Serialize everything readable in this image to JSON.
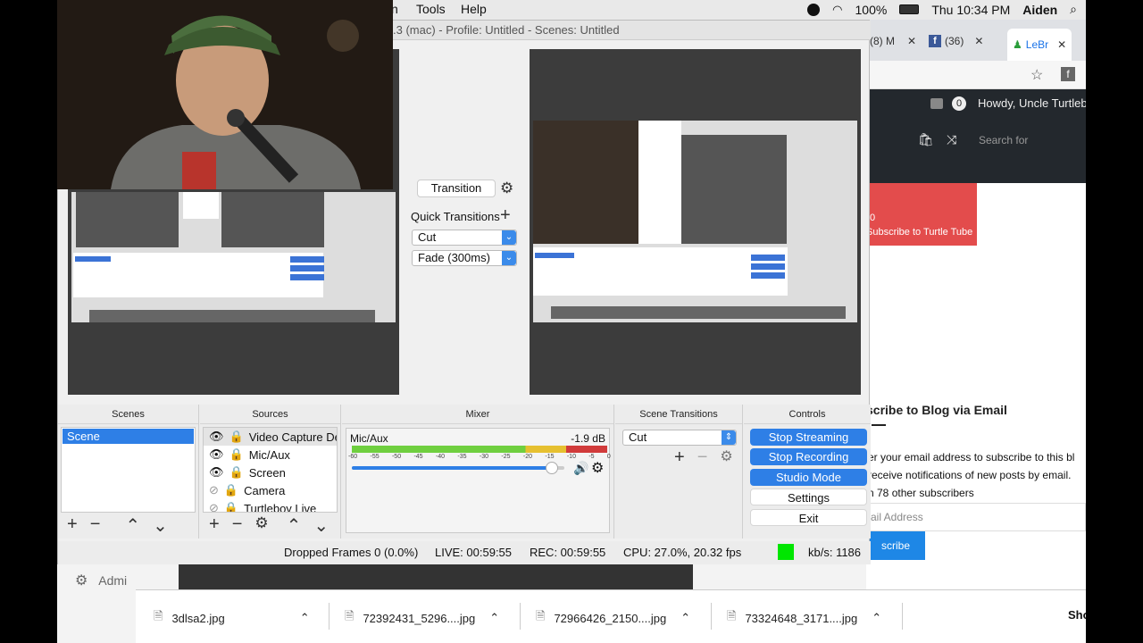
{
  "menubar": {
    "items": [
      "n",
      "Tools",
      "Help"
    ],
    "battery": "100%",
    "datetime": "Thu 10:34 PM",
    "user": "Aiden"
  },
  "browser": {
    "tabs": [
      "(8) M",
      "(36)",
      "LeBr"
    ],
    "wp_greeting": "Howdy, Uncle Turtleb",
    "search_placeholder": "Search for",
    "red_button": "Subscribe to Turtle Tube",
    "red_button_prefix": "0",
    "blog_heading": "scribe to Blog via Email",
    "blog_line1": "er your email address to subscribe to this bl",
    "blog_line2": "receive notifications of new posts by email.",
    "blog_line3": "n 78 other subscribers",
    "email_placeholder": "ail Address",
    "subscribe_btn": "scribe"
  },
  "obs": {
    "title": ".3 (mac) - Profile: Untitled - Scenes: Untitled",
    "transition_btn": "Transition",
    "quick_transitions": "Quick Transitions",
    "quick_cut": "Cut",
    "quick_fade": "Fade (300ms)",
    "panels": {
      "scenes": "Scenes",
      "sources": "Sources",
      "mixer": "Mixer",
      "scene_transitions": "Scene Transitions",
      "controls": "Controls"
    },
    "scenes": [
      "Scene"
    ],
    "sources": [
      "Video Capture Dev",
      "Mic/Aux",
      "Screen",
      "Camera",
      "Turtleboy Live"
    ],
    "mixer": {
      "name": "Mic/Aux",
      "db": "-1.9 dB",
      "ticks": [
        "-60",
        "-55",
        "-50",
        "-45",
        "-40",
        "-35",
        "-30",
        "-25",
        "-20",
        "-15",
        "-10",
        "-5",
        "0"
      ],
      "volume_level": 0.94
    },
    "scene_transition_value": "Cut",
    "controls": {
      "stop_streaming": "Stop Streaming",
      "stop_recording": "Stop Recording",
      "studio_mode": "Studio Mode",
      "settings": "Settings",
      "exit": "Exit"
    },
    "status": {
      "dropped": "Dropped Frames 0 (0.0%)",
      "live": "LIVE: 00:59:55",
      "rec": "REC: 00:59:55",
      "cpu": "CPU: 27.0%, 20.32 fps",
      "kbs": "kb/s: 1186"
    }
  },
  "admin_label": "Admi",
  "downloads": [
    "3dlsa2.jpg",
    "72392431_5296....jpg",
    "72966426_2150....jpg",
    "73324648_3171....jpg"
  ],
  "downloads_show": "Sho",
  "colors": {
    "accent": "#2e7fe6",
    "live_indicator": "#00e600",
    "wp_bar": "#23282d",
    "subscribe_red": "#e34c4c"
  }
}
